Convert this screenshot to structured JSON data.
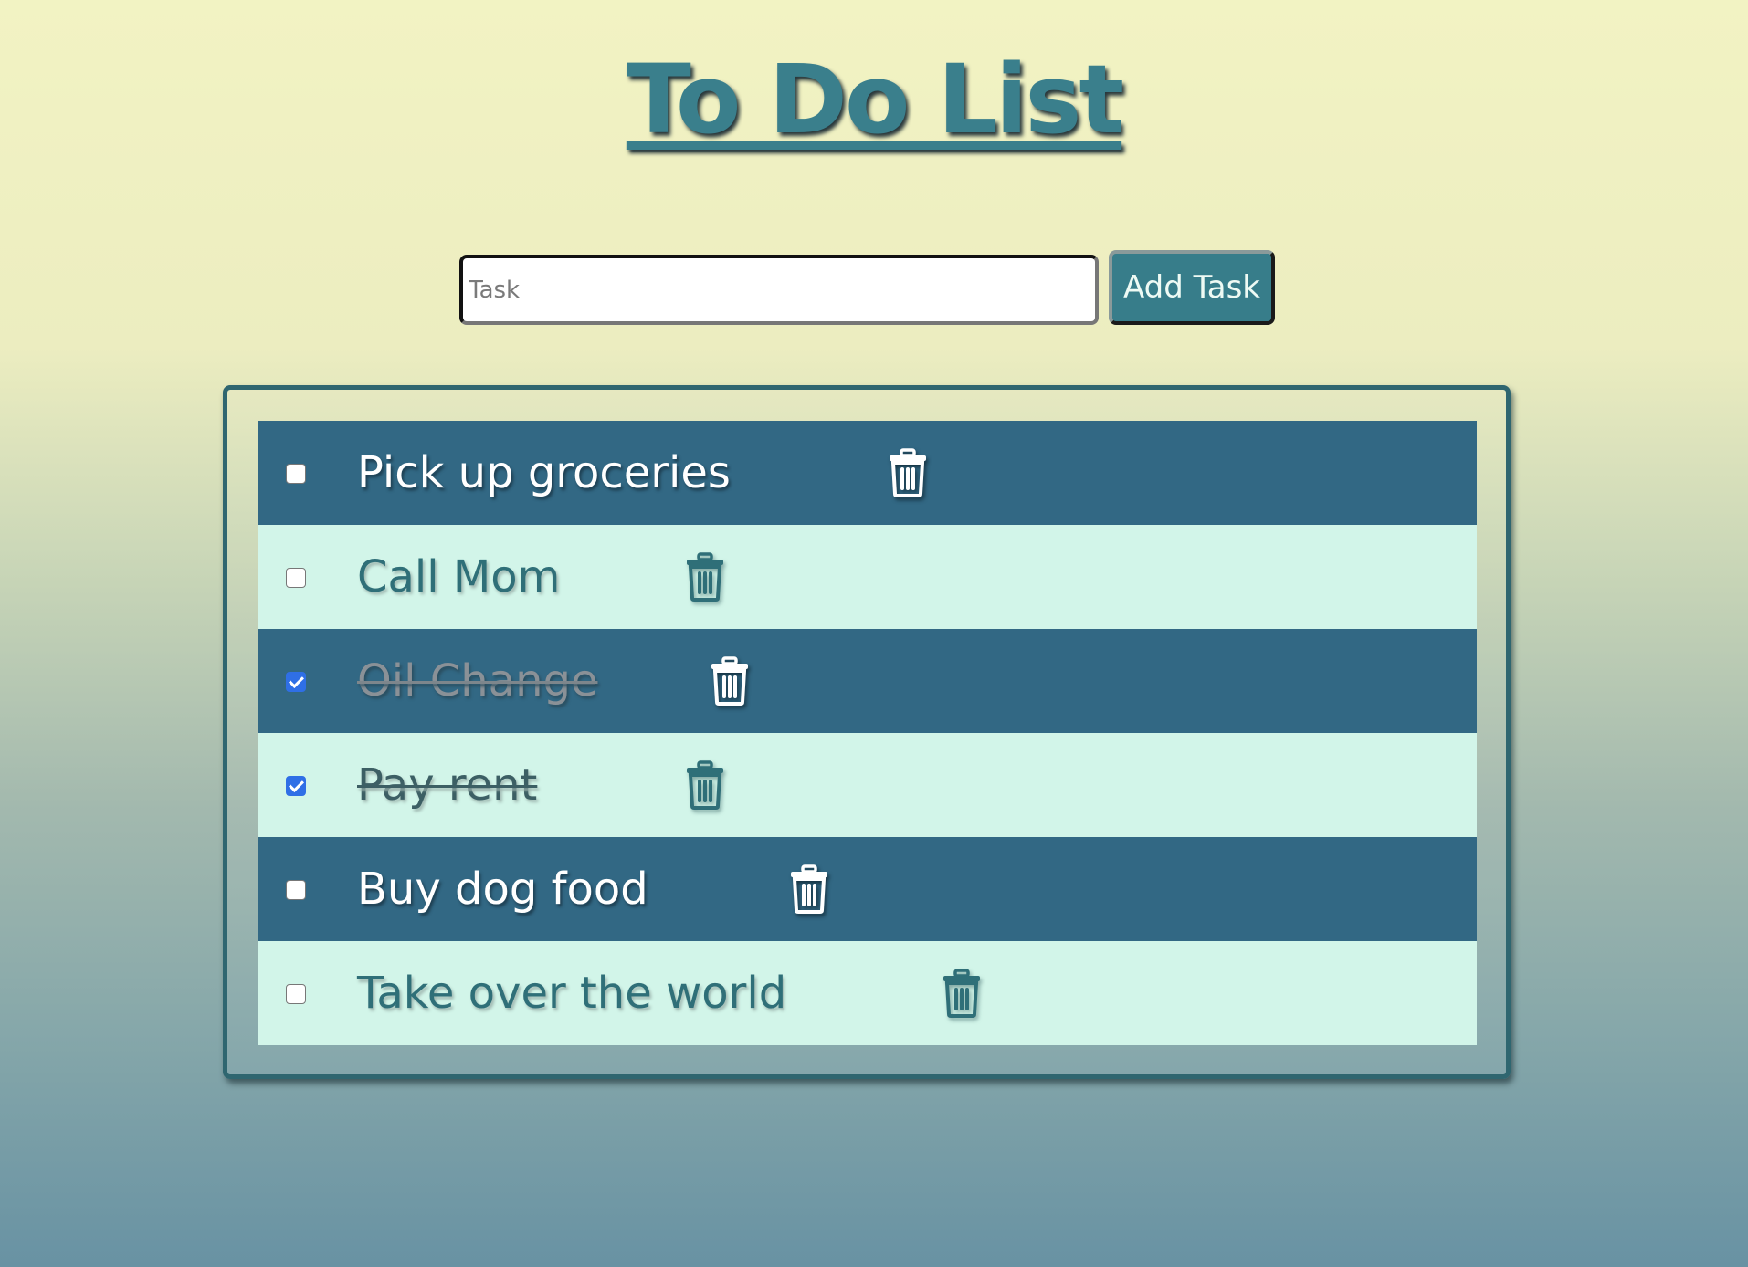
{
  "title": "To Do List",
  "form": {
    "placeholder": "Task",
    "value": "",
    "add_label": "Add Task"
  },
  "colors": {
    "accent": "#377d8a",
    "row_dark": "#326884",
    "row_light": "#d2f5e9",
    "checkbox_checked": "#2f6fe6"
  },
  "tasks": [
    {
      "label": "Pick up groceries",
      "done": false,
      "icon": "trash-icon"
    },
    {
      "label": "Call Mom",
      "done": false,
      "icon": "trash-icon"
    },
    {
      "label": "Oil Change",
      "done": true,
      "icon": "trash-icon"
    },
    {
      "label": "Pay rent",
      "done": true,
      "icon": "trash-icon"
    },
    {
      "label": "Buy dog food",
      "done": false,
      "icon": "trash-icon"
    },
    {
      "label": "Take over the world",
      "done": false,
      "icon": "trash-icon"
    }
  ]
}
